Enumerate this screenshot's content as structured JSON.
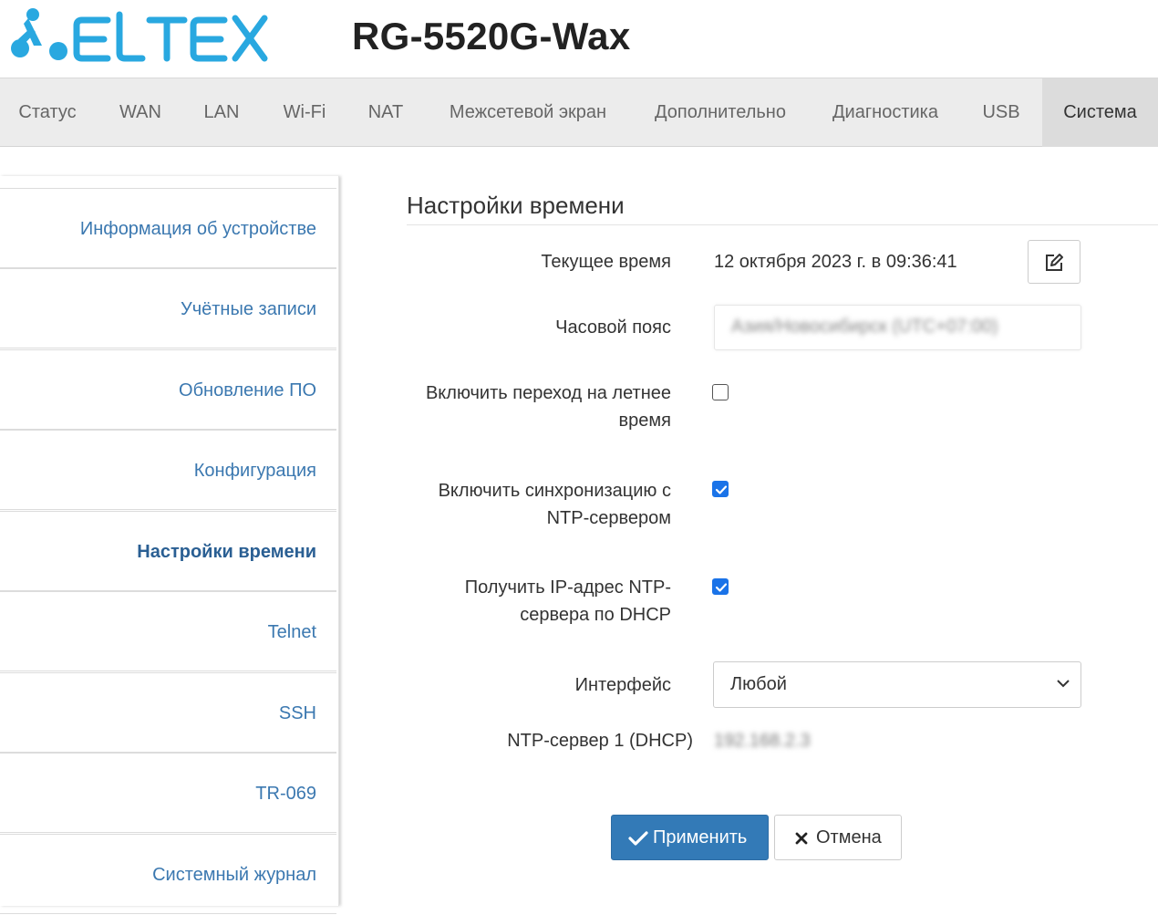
{
  "header": {
    "logo_text": "ELTEX",
    "model": "RG-5520G-Wax"
  },
  "topnav": {
    "items": [
      {
        "label": "Статус"
      },
      {
        "label": "WAN"
      },
      {
        "label": "LAN"
      },
      {
        "label": "Wi-Fi"
      },
      {
        "label": "NAT"
      },
      {
        "label": "Межсетевой экран"
      },
      {
        "label": "Дополнительно"
      },
      {
        "label": "Диагностика"
      },
      {
        "label": "USB"
      },
      {
        "label": "Система"
      }
    ],
    "active": "Система"
  },
  "sidebar": {
    "items": [
      {
        "label": "Информация об устройстве"
      },
      {
        "label": "Учётные записи"
      },
      {
        "label": "Обновление ПО"
      },
      {
        "label": "Конфигурация"
      },
      {
        "label": "Настройки времени"
      },
      {
        "label": "Telnet"
      },
      {
        "label": "SSH"
      },
      {
        "label": "TR-069"
      },
      {
        "label": "Системный журнал"
      }
    ],
    "active": "Настройки времени"
  },
  "main": {
    "title": "Настройки времени",
    "current_time_label": "Текущее время",
    "current_time_value": "12 октября 2023 г. в 09:36:41",
    "timezone_label": "Часовой пояс",
    "timezone_value": "Азия/Новосибирск (UTC+07:00)",
    "dst_label": "Включить переход на летнее время",
    "dst_checked": false,
    "ntp_sync_label": "Включить синхронизацию с NTP-сервером",
    "ntp_sync_checked": true,
    "ntp_dhcp_label": "Получить IP-адрес NTP-сервера по DHCP",
    "ntp_dhcp_checked": true,
    "interface_label": "Интерфейс",
    "interface_value": "Любой",
    "ntp_server_label": "NTP-сервер 1 (DHCP)",
    "ntp_server_value": "192.168.2.3",
    "apply_label": "Применить",
    "cancel_label": "Отмена",
    "accent_color": "#337ab7",
    "checkbox_color": "#1a73e8",
    "logo_color": "#29a8e0"
  }
}
